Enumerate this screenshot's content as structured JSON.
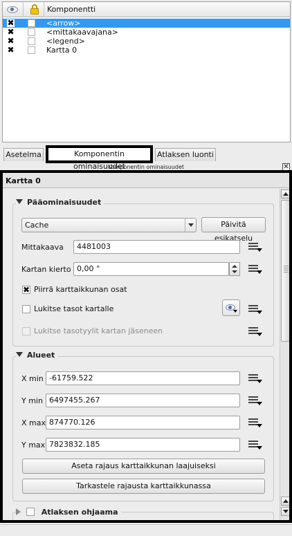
{
  "items_panel": {
    "header": {
      "component_col": "Komponentti"
    },
    "rows": [
      {
        "name": "<arrow>",
        "visible": true,
        "locked": false,
        "selected": true
      },
      {
        "name": "<mittakaavajana>",
        "visible": true,
        "locked": false,
        "selected": false
      },
      {
        "name": "<legend>",
        "visible": true,
        "locked": false,
        "selected": false
      },
      {
        "name": "Kartta 0",
        "visible": true,
        "locked": false,
        "selected": false
      }
    ]
  },
  "tabs": [
    {
      "label": "Asetelma"
    },
    {
      "label": "Komponentin ominaisuudet",
      "active": true
    },
    {
      "label": "Atlaksen luonti"
    }
  ],
  "dock": {
    "title": "Komponentin ominaisuudet",
    "close": "✕"
  },
  "props": {
    "item_title": "Kartta 0",
    "main": {
      "title": "Pääominaisuudet",
      "cache_value": "Cache",
      "refresh_button": "Päivitä esikatselu",
      "scale_label": "Mittakaava",
      "scale_value": "4481003",
      "rotation_label": "Kartan kierto",
      "rotation_value": "0,00 °",
      "draw_canvas_label": "Piirrä karttaikkunan osat",
      "draw_canvas_checked": true,
      "lock_layers_label": "Lukitse tasot kartalle",
      "lock_layers_checked": false,
      "lock_styles_label": "Lukitse tasotyylit kartan jäseneen",
      "lock_styles_checked": false
    },
    "extents": {
      "title": "Alueet",
      "xmin_label": "X min",
      "xmin_value": "-61759.522",
      "ymin_label": "Y min",
      "ymin_value": "6497455.267",
      "xmax_label": "X max",
      "xmax_value": "874770.126",
      "ymax_label": "Y max",
      "ymax_value": "7823832.185",
      "set_extent_button": "Aseta rajaus karttaikkunan laajuiseksi",
      "view_extent_button": "Tarkastele rajausta karttaikkunassa"
    },
    "atlas": {
      "title": "Atlaksen ohjaama",
      "checked": false
    }
  }
}
